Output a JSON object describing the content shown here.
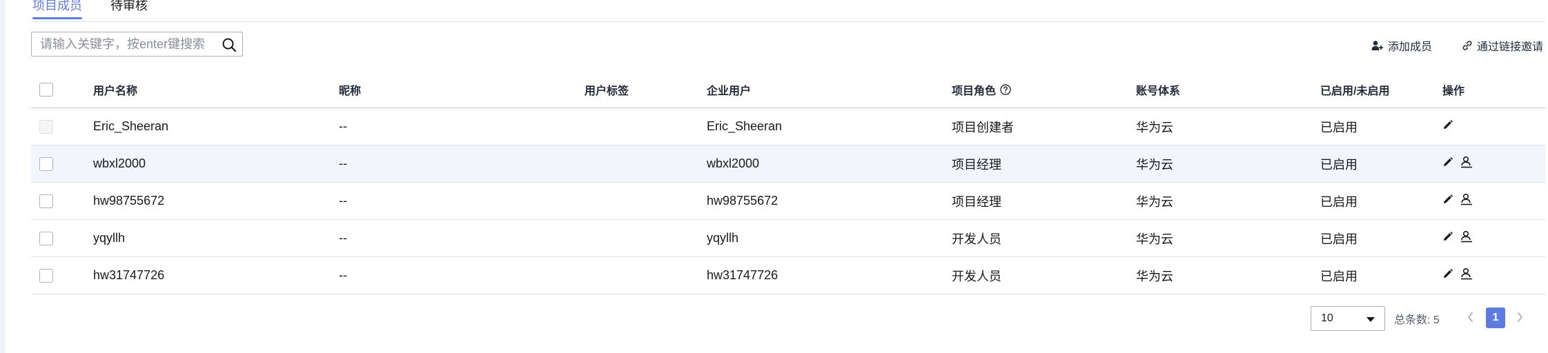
{
  "tabs": [
    {
      "label": "项目成员",
      "active": true
    },
    {
      "label": "待审核",
      "active": false
    }
  ],
  "search": {
    "placeholder": "请输入关键字，按enter键搜索",
    "value": ""
  },
  "actions": {
    "add_member": "添加成员",
    "invite_link": "通过链接邀请"
  },
  "table": {
    "headers": [
      "用户名称",
      "昵称",
      "用户标签",
      "企业用户",
      "项目角色",
      "账号体系",
      "已启用/未启用",
      "操作"
    ],
    "rows": [
      {
        "username": "Eric_Sheeran",
        "nickname": "--",
        "tag": "",
        "enterprise_user": "Eric_Sheeran",
        "role": "项目创建者",
        "account_system": "华为云",
        "status": "已启用",
        "checkbox_disabled": true,
        "actions": [
          "edit-icon"
        ]
      },
      {
        "username": "wbxl2000",
        "nickname": "--",
        "tag": "",
        "enterprise_user": "wbxl2000",
        "role": "项目经理",
        "account_system": "华为云",
        "status": "已启用",
        "checkbox_disabled": false,
        "actions": [
          "edit-icon",
          "user-icon"
        ]
      },
      {
        "username": "hw98755672",
        "nickname": "--",
        "tag": "",
        "enterprise_user": "hw98755672",
        "role": "项目经理",
        "account_system": "华为云",
        "status": "已启用",
        "checkbox_disabled": false,
        "actions": [
          "edit-icon",
          "user-icon"
        ]
      },
      {
        "username": "yqyllh",
        "nickname": "--",
        "tag": "",
        "enterprise_user": "yqyllh",
        "role": "开发人员",
        "account_system": "华为云",
        "status": "已启用",
        "checkbox_disabled": false,
        "actions": [
          "edit-icon",
          "user-icon"
        ]
      },
      {
        "username": "hw31747726",
        "nickname": "--",
        "tag": "",
        "enterprise_user": "hw31747726",
        "role": "开发人员",
        "account_system": "华为云",
        "status": "已启用",
        "checkbox_disabled": false,
        "actions": [
          "edit-icon",
          "user-icon"
        ]
      }
    ]
  },
  "pagination": {
    "page_size": "10",
    "total_label": "总条数: 5",
    "current_page": "1"
  },
  "colors": {
    "accent": "#5e7ce0",
    "row_hover": "#f2f5fc",
    "border": "#dfe1e6"
  }
}
